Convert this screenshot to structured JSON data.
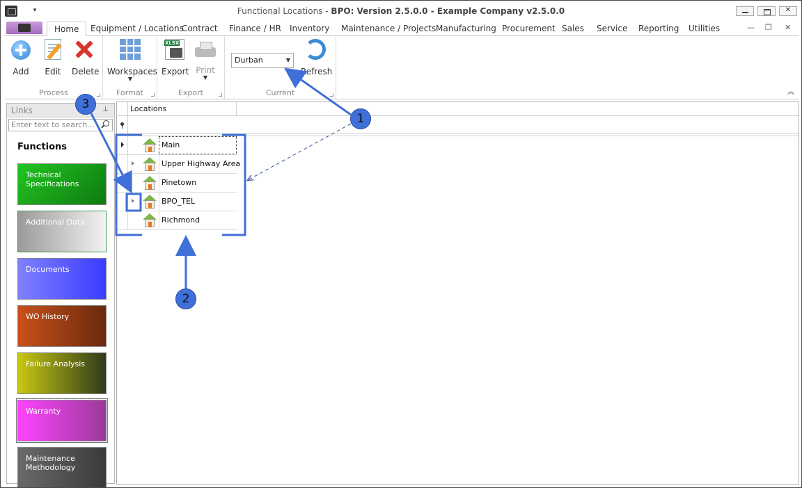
{
  "window": {
    "title_prefix": "Functional Locations",
    "title_sep": " - ",
    "title_main": "BPO: Version 2.5.0.0 - Example Company v2.5.0.0",
    "qa_arrow": "▾"
  },
  "tabs": [
    {
      "label": "Home"
    },
    {
      "label": "Equipment / Locations"
    },
    {
      "label": "Contract"
    },
    {
      "label": "Finance / HR"
    },
    {
      "label": "Inventory"
    },
    {
      "label": "Maintenance / Projects"
    },
    {
      "label": "Manufacturing"
    },
    {
      "label": "Procurement"
    },
    {
      "label": "Sales"
    },
    {
      "label": "Service"
    },
    {
      "label": "Reporting"
    },
    {
      "label": "Utilities"
    }
  ],
  "ribbon": {
    "process": {
      "caption": "Process",
      "add": "Add",
      "edit": "Edit",
      "delete": "Delete"
    },
    "format": {
      "caption": "Format",
      "workspaces": "Workspaces"
    },
    "export": {
      "caption": "Export",
      "export": "Export",
      "print": "Print"
    },
    "current": {
      "caption": "Current",
      "site": "Durban",
      "refresh": "Refresh"
    }
  },
  "links": {
    "title": "Links",
    "search_placeholder": "Enter text to search...",
    "functions_title": "Functions",
    "tiles": [
      {
        "label": "Technical\nSpecifications",
        "color": "#1ea51e"
      },
      {
        "label": "Additional Data",
        "color": "#c0c0c0"
      },
      {
        "label": "Documents",
        "color": "#3a3cff"
      },
      {
        "label": "WO History",
        "color": "#b8481a"
      },
      {
        "label": "Failure Analysis",
        "color": "#a9a918"
      },
      {
        "label": "Warranty",
        "color": "#d23bc7"
      },
      {
        "label": "Maintenance\nMethodology",
        "color": "#555555"
      }
    ]
  },
  "grid": {
    "column": "Locations",
    "rows": [
      {
        "name": "Main",
        "expandable": false,
        "current": true
      },
      {
        "name": "Upper Highway Area",
        "expandable": true,
        "current": false
      },
      {
        "name": "Pinetown",
        "expandable": false,
        "current": false
      },
      {
        "name": "BPO_TEL",
        "expandable": true,
        "current": false
      },
      {
        "name": "Richmond",
        "expandable": false,
        "current": false
      }
    ]
  },
  "annotations": {
    "badge1": "1",
    "badge2": "2",
    "badge3": "3",
    "color": "#3f6fd8"
  }
}
